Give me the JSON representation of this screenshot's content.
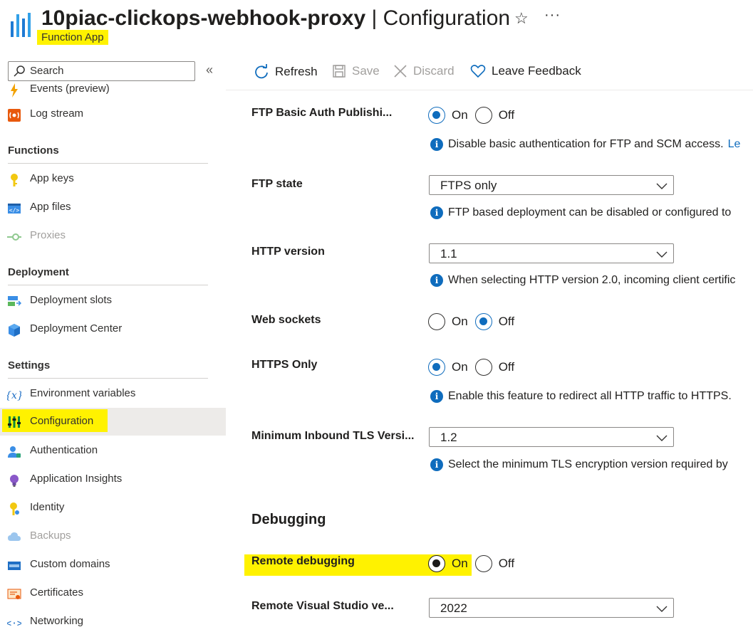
{
  "header": {
    "resource_name": "10piac-clickops-webhook-proxy",
    "separator": " | ",
    "page_name": "Configuration",
    "subtitle": "Function App",
    "star_icon": "star-icon",
    "more_label": "···"
  },
  "sidebar": {
    "search_placeholder": "Search",
    "collapse_label": "«",
    "items_top": [
      {
        "label": "Events (preview)",
        "icon": "lightning-icon"
      },
      {
        "label": "Log stream",
        "icon": "log-stream-icon"
      }
    ],
    "sections": [
      {
        "title": "Functions",
        "items": [
          {
            "label": "App keys",
            "icon": "key-icon"
          },
          {
            "label": "App files",
            "icon": "code-file-icon"
          },
          {
            "label": "Proxies",
            "icon": "proxy-icon",
            "disabled": true
          }
        ]
      },
      {
        "title": "Deployment",
        "items": [
          {
            "label": "Deployment slots",
            "icon": "slots-icon"
          },
          {
            "label": "Deployment Center",
            "icon": "cube-icon"
          }
        ]
      },
      {
        "title": "Settings",
        "items": [
          {
            "label": "Environment variables",
            "icon": "variable-icon"
          },
          {
            "label": "Configuration",
            "icon": "configuration-icon",
            "active": true
          },
          {
            "label": "Authentication",
            "icon": "user-auth-icon"
          },
          {
            "label": "Application Insights",
            "icon": "lightbulb-icon"
          },
          {
            "label": "Identity",
            "icon": "identity-key-icon"
          },
          {
            "label": "Backups",
            "icon": "cloud-backup-icon",
            "disabled": true
          },
          {
            "label": "Custom domains",
            "icon": "www-icon"
          },
          {
            "label": "Certificates",
            "icon": "certificate-icon"
          },
          {
            "label": "Networking",
            "icon": "network-icon"
          }
        ]
      }
    ]
  },
  "toolbar": {
    "refresh": "Refresh",
    "save": "Save",
    "discard": "Discard",
    "feedback": "Leave Feedback"
  },
  "settings": {
    "ftp_basic_auth": {
      "label": "FTP Basic Auth Publishi...",
      "on": "On",
      "off": "Off",
      "selected": "On",
      "info": "Disable basic authentication for FTP and SCM access.",
      "info_link": "Le"
    },
    "ftp_state": {
      "label": "FTP state",
      "value": "FTPS only",
      "info": "FTP based deployment can be disabled or configured to"
    },
    "http_version": {
      "label": "HTTP version",
      "value": "1.1",
      "info": "When selecting HTTP version 2.0, incoming client certific"
    },
    "web_sockets": {
      "label": "Web sockets",
      "on": "On",
      "off": "Off",
      "selected": "Off"
    },
    "https_only": {
      "label": "HTTPS Only",
      "on": "On",
      "off": "Off",
      "selected": "On",
      "info": "Enable this feature to redirect all HTTP traffic to HTTPS."
    },
    "min_tls": {
      "label": "Minimum Inbound TLS Versi...",
      "value": "1.2",
      "info": "Select the minimum TLS encryption version required by"
    },
    "debugging_title": "Debugging",
    "remote_debugging": {
      "label": "Remote debugging",
      "on": "On",
      "off": "Off",
      "selected": "On"
    },
    "remote_vs_version": {
      "label": "Remote Visual Studio ve...",
      "value": "2022"
    }
  },
  "colors": {
    "accent": "#0f6cbd",
    "highlight": "#fff200"
  }
}
